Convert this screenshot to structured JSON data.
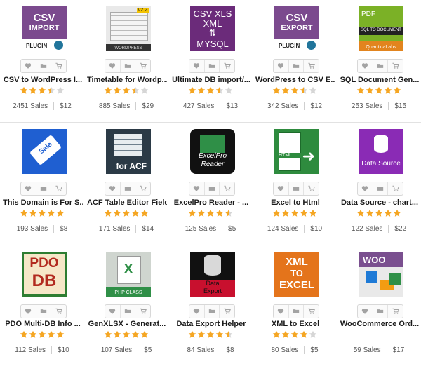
{
  "products": [
    {
      "title": "CSV to WordPress I...",
      "sales": "2451 Sales",
      "price": "$12",
      "rating": 3.5,
      "thumb": {
        "icon": "csv-import-plugin-icon",
        "lines": [
          "CSV",
          "IMPORT",
          "PLUGIN"
        ],
        "bg": "#7b4a8e"
      }
    },
    {
      "title": "Timetable for Wordp...",
      "sales": "885 Sales",
      "price": "$29",
      "rating": 3.5,
      "thumb": {
        "icon": "timetable-icon",
        "lines": [
          "v2.2",
          "WORDPRESS"
        ],
        "bg": "#e9e9e9"
      }
    },
    {
      "title": "Ultimate DB import/...",
      "sales": "427 Sales",
      "price": "$13",
      "rating": 3.5,
      "thumb": {
        "icon": "csv-xls-xml-mysql-icon",
        "lines": [
          "CSV XLS",
          "XML",
          "MYSQL"
        ],
        "bg": "#6b2b7a"
      }
    },
    {
      "title": "WordPress to CSV E...",
      "sales": "342 Sales",
      "price": "$12",
      "rating": 3.5,
      "thumb": {
        "icon": "csv-export-plugin-icon",
        "lines": [
          "CSV",
          "EXPORT",
          "PLUGIN"
        ],
        "bg": "#7b4a8e"
      }
    },
    {
      "title": "SQL Document Gen...",
      "sales": "253 Sales",
      "price": "$15",
      "rating": 5,
      "thumb": {
        "icon": "sql-document-icon",
        "lines": [
          "PDF",
          "SQL TO DOCUMENT",
          "QuanticaLabs"
        ],
        "bg": "#7bb126"
      }
    },
    {
      "title": "This Domain is For S...",
      "sales": "193 Sales",
      "price": "$8",
      "rating": 5,
      "thumb": {
        "icon": "sale-tag-icon",
        "lines": [
          "Sale"
        ],
        "bg": "#1f5fd1"
      }
    },
    {
      "title": "ACF Table Editor Field",
      "sales": "171 Sales",
      "price": "$14",
      "rating": 5,
      "thumb": {
        "icon": "acf-table-icon",
        "lines": [
          "for ACF"
        ],
        "bg": "#2b3a46"
      }
    },
    {
      "title": "ExcelPro Reader - ...",
      "sales": "125 Sales",
      "price": "$5",
      "rating": 4.5,
      "thumb": {
        "icon": "excelpro-reader-icon",
        "lines": [
          "ExcelPro",
          "Reader"
        ],
        "bg": "#111111"
      }
    },
    {
      "title": "Excel to Html",
      "sales": "124 Sales",
      "price": "$10",
      "rating": 5,
      "thumb": {
        "icon": "excel-to-html-icon",
        "lines": [
          "HTML",
          "PAGE"
        ],
        "bg": "#2e8b3e"
      }
    },
    {
      "title": "Data Source - chart...",
      "sales": "122 Sales",
      "price": "$22",
      "rating": 5,
      "thumb": {
        "icon": "data-source-icon",
        "lines": [
          "Data Source"
        ],
        "bg": "#8a2bb5"
      }
    },
    {
      "title": "PDO Multi-DB Info ...",
      "sales": "112 Sales",
      "price": "$10",
      "rating": 5,
      "thumb": {
        "icon": "pdo-db-icon",
        "lines": [
          "PDO",
          "DB"
        ],
        "bg": "#f6e7c8"
      }
    },
    {
      "title": "GenXLSX - Generat...",
      "sales": "107 Sales",
      "price": "$5",
      "rating": 5,
      "thumb": {
        "icon": "genxlsx-icon",
        "lines": [
          "PHP CLASS"
        ],
        "bg": "#cfd5cf"
      }
    },
    {
      "title": "Data Export Helper",
      "sales": "84 Sales",
      "price": "$8",
      "rating": 4.5,
      "thumb": {
        "icon": "data-export-icon",
        "lines": [
          "Data",
          "Export"
        ],
        "bg": "#111111"
      }
    },
    {
      "title": "XML to Excel",
      "sales": "80 Sales",
      "price": "$5",
      "rating": 4,
      "thumb": {
        "icon": "xml-to-excel-icon",
        "lines": [
          "XML",
          "TO",
          "EXCEL"
        ],
        "bg": "#e4741b"
      }
    },
    {
      "title": "WooCommerce Ord...",
      "sales": "59 Sales",
      "price": "$17",
      "rating": 0,
      "thumb": {
        "icon": "woocommerce-order-export-icon",
        "lines": [
          "WOO"
        ],
        "bg": "#7a4f8f"
      }
    }
  ],
  "action_icons": [
    "heart-icon",
    "folder-icon",
    "cart-icon"
  ],
  "colors": {
    "star": "#f5a623",
    "star_empty": "#d6d6d6"
  }
}
